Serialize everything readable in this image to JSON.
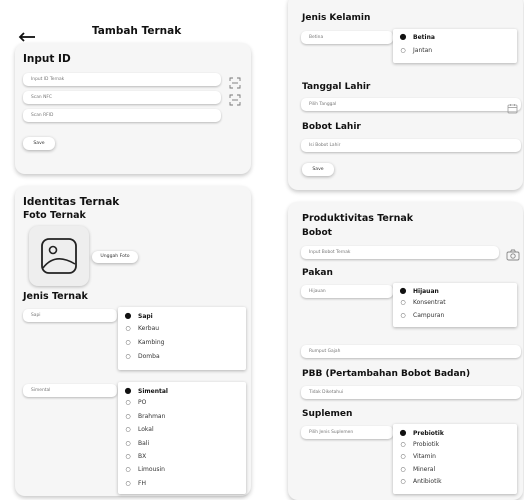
{
  "header": {
    "title": "Tambah Ternak",
    "back_icon": "back-arrow-icon"
  },
  "input_id": {
    "title": "Input ID",
    "fields": [
      {
        "placeholder": "Input ID Ternak",
        "icon": "scan-icon"
      },
      {
        "placeholder": "Scan NFC",
        "icon": "scan-icon"
      },
      {
        "placeholder": "Scan RFID"
      }
    ],
    "save_label": "Save"
  },
  "identitas": {
    "title": "Identitas Ternak",
    "foto_label": "Foto Ternak",
    "upload_label": "Unggah Foto",
    "jenis_label": "Jenis Ternak",
    "jenis_field": "Sapi",
    "jenis_options": [
      "Sapi",
      "Kerbau",
      "Kambing",
      "Domba"
    ],
    "jenis_selected": 0,
    "ras_field": "Simental",
    "ras_options": [
      "Simental",
      "PO",
      "Brahman",
      "Lokal",
      "Bali",
      "BX",
      "Limousin",
      "FH"
    ],
    "ras_selected": 0
  },
  "data_lahir": {
    "kelamin_label": "Jenis Kelamin",
    "kelamin_field": "Betina",
    "kelamin_options": [
      "Betina",
      "Jantan"
    ],
    "kelamin_selected": 0,
    "tanggal_label": "Tanggal Lahir",
    "tanggal_placeholder": "Pilih Tanggal",
    "bobot_label": "Bobot Lahir",
    "bobot_placeholder": "Isi Bobot Lahir",
    "save_label": "Save"
  },
  "produktivitas": {
    "title": "Produktivitas Ternak",
    "bobot_label": "Bobot",
    "bobot_placeholder": "Input Bobot Ternak",
    "pakan_label": "Pakan",
    "pakan_field": "Hijauan",
    "pakan_options": [
      "Hijauan",
      "Konsentrat",
      "Campuran"
    ],
    "pakan_selected": 0,
    "rumput_field": "Rumput Gajah",
    "pbb_label": "PBB (Pertambahan Bobot Badan)",
    "pbb_placeholder": "Tidak Diketahui",
    "suplemen_label": "Suplemen",
    "suplemen_field": "Pilih Jenis Suplemen",
    "suplemen_options": [
      "Prebiotik",
      "Probiotik",
      "Vitamin",
      "Mineral",
      "Antibiotik"
    ],
    "suplemen_selected": 0
  }
}
